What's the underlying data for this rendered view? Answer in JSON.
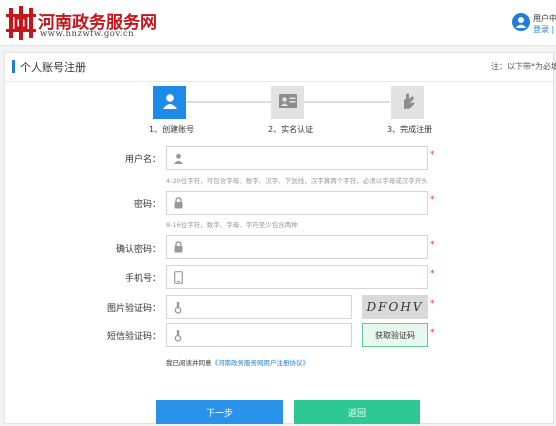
{
  "header": {
    "site_name": "河南政务服务网",
    "domain": "www.hnzwfw.gov.cn",
    "user_title": "用户中",
    "login_link": "登录",
    "separator": "|"
  },
  "section": {
    "title": "个人账号注册",
    "note": "注：以下带*为必填"
  },
  "steps": [
    {
      "label": "1、创建账号",
      "icon": "user-icon",
      "active": true
    },
    {
      "label": "2、实名认证",
      "icon": "id-card-icon",
      "active": false
    },
    {
      "label": "3、完成注册",
      "icon": "hand-icon",
      "active": false
    }
  ],
  "form": {
    "username": {
      "label": "用户名：",
      "value": "",
      "hint": "4-20位字符，可包含字母、数字、汉字、下划线，汉字算两个字符，必须以字母或汉字开头"
    },
    "password": {
      "label": "密码：",
      "value": "",
      "hint": "8-16位字符，数字、字母、字符至少包含两种"
    },
    "confirm": {
      "label": "确认密码：",
      "value": ""
    },
    "phone": {
      "label": "手机号：",
      "value": ""
    },
    "image_code": {
      "label": "图片验证码：",
      "value": "",
      "captcha_text": "DFOHV"
    },
    "sms_code": {
      "label": "短信验证码：",
      "value": "",
      "button": "获取验证码"
    },
    "required_mark": "*"
  },
  "agreement": {
    "prefix": "我已阅读并同意",
    "link": "《河南政务服务网用户注册协议》"
  },
  "buttons": {
    "next": "下一步",
    "back": "返回"
  },
  "colors": {
    "brand_red": "#c4161c",
    "primary_blue": "#2a92e8",
    "green": "#2ec895"
  }
}
